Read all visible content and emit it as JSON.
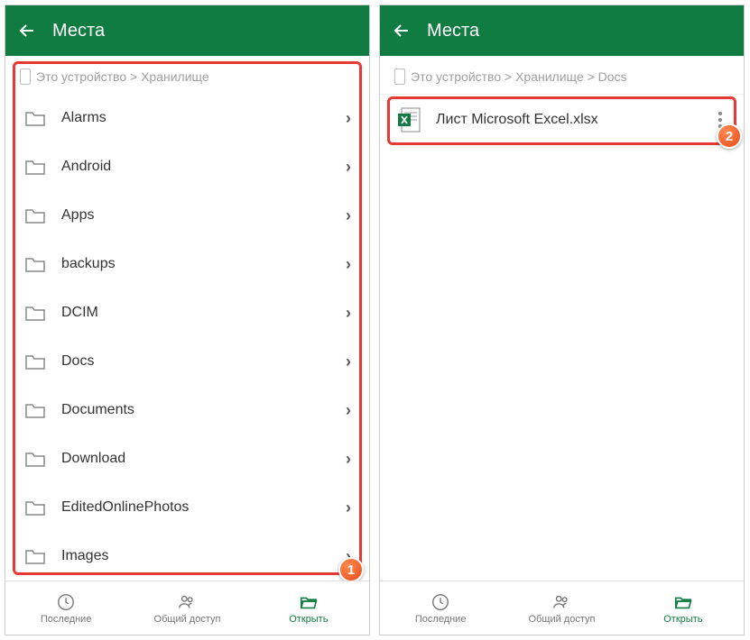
{
  "left": {
    "title": "Места",
    "breadcrumb": "Это устройство > Хранилище",
    "folders": [
      {
        "name": "Alarms"
      },
      {
        "name": "Android"
      },
      {
        "name": "Apps"
      },
      {
        "name": "backups"
      },
      {
        "name": "DCIM"
      },
      {
        "name": "Docs"
      },
      {
        "name": "Documents"
      },
      {
        "name": "Download"
      },
      {
        "name": "EditedOnlinePhotos"
      },
      {
        "name": "Images"
      }
    ],
    "badge": "1"
  },
  "right": {
    "title": "Места",
    "breadcrumb": "Это устройство > Хранилище > Docs",
    "file": "Лист Microsoft Excel.xlsx",
    "badge": "2"
  },
  "nav": {
    "recent": "Последние",
    "shared": "Общий доступ",
    "open": "Открыть"
  }
}
